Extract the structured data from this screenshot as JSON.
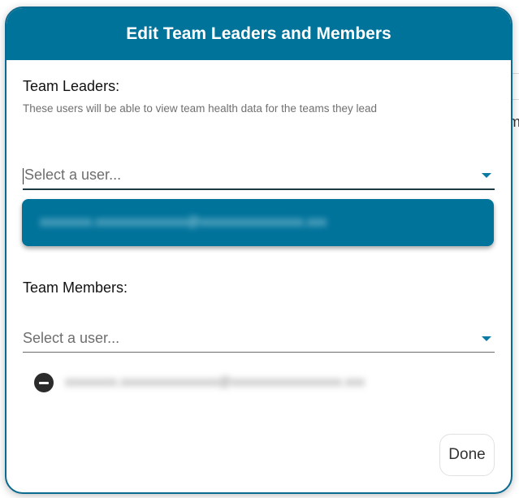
{
  "dialog": {
    "title": "Edit Team Leaders and Members"
  },
  "leaders": {
    "title": "Team Leaders:",
    "description": "These users will be able to view team health data for the teams they lead",
    "select_placeholder": "Select a user...",
    "selected_user": "xxxxxxxx.xxxxxxxxxxxxxx@xxxxxxxxxxxxxxxx.xxx"
  },
  "members": {
    "title": "Team Members:",
    "select_placeholder": "Select a user...",
    "items": [
      {
        "email": "xxxxxxxx.xxxxxxxxxxxxxxx@xxxxxxxxxxxxxxxxx.xxx"
      }
    ]
  },
  "actions": {
    "done_label": "Done"
  },
  "colors": {
    "header_bg": "#00739b",
    "chip_bg": "#00739b",
    "accent": "#0b7aa3"
  },
  "background": {
    "peek_text": "m"
  }
}
